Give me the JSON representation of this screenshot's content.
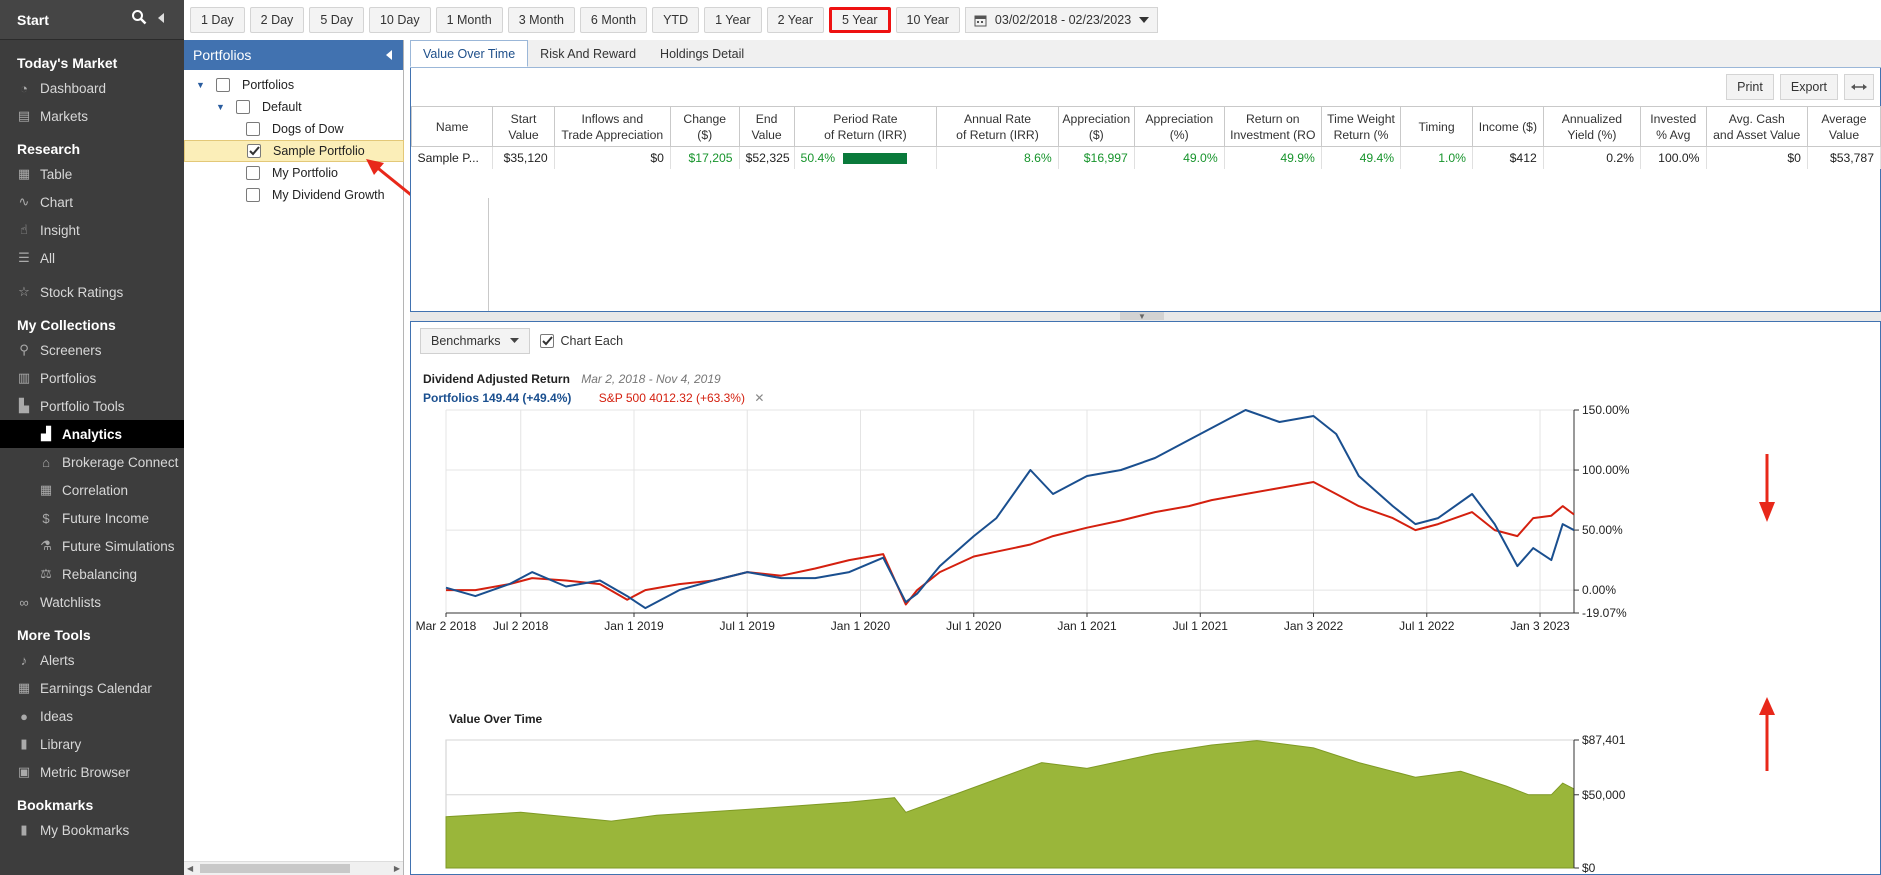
{
  "sidebar": {
    "start_label": "Start",
    "sections": [
      {
        "title": "Today's Market",
        "items": [
          {
            "label": "Dashboard",
            "icon": "dashboard-icon"
          },
          {
            "label": "Markets",
            "icon": "markets-icon"
          }
        ]
      },
      {
        "title": "Research",
        "items": [
          {
            "label": "Table",
            "icon": "table-icon"
          },
          {
            "label": "Chart",
            "icon": "chart-icon"
          },
          {
            "label": "Insight",
            "icon": "insight-icon"
          },
          {
            "label": "All",
            "icon": "list-icon"
          },
          {
            "label": "Stock Ratings",
            "icon": "star-icon"
          }
        ]
      },
      {
        "title": "My Collections",
        "items": [
          {
            "label": "Screeners",
            "icon": "search-icon"
          },
          {
            "label": "Portfolios",
            "icon": "portfolios-icon"
          },
          {
            "label": "Portfolio Tools",
            "icon": "portfolio-tools-icon"
          },
          {
            "label": "Analytics",
            "icon": "analytics-icon",
            "sub": true,
            "active": true
          },
          {
            "label": "Brokerage Connect",
            "icon": "bank-icon",
            "sub": true
          },
          {
            "label": "Correlation",
            "icon": "grid-icon",
            "sub": true
          },
          {
            "label": "Future Income",
            "icon": "dollar-icon",
            "sub": true
          },
          {
            "label": "Future Simulations",
            "icon": "flask-icon",
            "sub": true
          },
          {
            "label": "Rebalancing",
            "icon": "scale-icon",
            "sub": true
          },
          {
            "label": "Watchlists",
            "icon": "binoculars-icon"
          }
        ]
      },
      {
        "title": "More Tools",
        "items": [
          {
            "label": "Alerts",
            "icon": "bell-icon"
          },
          {
            "label": "Earnings Calendar",
            "icon": "calendar-icon"
          },
          {
            "label": "Ideas",
            "icon": "lightbulb-icon"
          },
          {
            "label": "Library",
            "icon": "book-icon"
          },
          {
            "label": "Metric Browser",
            "icon": "browser-icon"
          }
        ]
      },
      {
        "title": "Bookmarks",
        "items": [
          {
            "label": "My Bookmarks",
            "icon": "bookmark-icon"
          }
        ]
      }
    ]
  },
  "periods": [
    "1 Day",
    "2 Day",
    "5 Day",
    "10 Day",
    "1 Month",
    "3 Month",
    "6 Month",
    "YTD",
    "1 Year",
    "2 Year",
    "5 Year",
    "10 Year"
  ],
  "selected_period": "5 Year",
  "date_range": "03/02/2018 - 02/23/2023",
  "portfolios_panel": {
    "title": "Portfolios",
    "root": "Portfolios",
    "group": "Default",
    "items": [
      {
        "label": "Dogs of Dow",
        "checked": false
      },
      {
        "label": "Sample Portfolio",
        "checked": true
      },
      {
        "label": "My Portfolio",
        "checked": false
      },
      {
        "label": "My Dividend Growth",
        "checked": false
      }
    ]
  },
  "tabs": [
    "Value Over Time",
    "Risk And Reward",
    "Holdings Detail"
  ],
  "table_tools": {
    "print": "Print",
    "export": "Export"
  },
  "table": {
    "headers": [
      [
        "Name"
      ],
      [
        "Start",
        "Value"
      ],
      [
        "Inflows and",
        "Trade Appreciation"
      ],
      [
        "Change",
        "($)"
      ],
      [
        "End",
        "Value"
      ],
      [
        "Period Rate",
        "of Return (IRR)"
      ],
      [
        "Annual Rate",
        "of Return (IRR)"
      ],
      [
        "Appreciation",
        "($)"
      ],
      [
        "Appreciation",
        "(%)"
      ],
      [
        "Return on",
        "Investment (RO"
      ],
      [
        "Time Weight",
        "Return (%"
      ],
      [
        "Timing"
      ],
      [
        "Income ($)"
      ],
      [
        "Annualized",
        "Yield (%)"
      ],
      [
        "Invested",
        "% Avg"
      ],
      [
        "Avg. Cash",
        "and Asset Value"
      ],
      [
        "Average",
        "Value"
      ]
    ],
    "row": {
      "name": "Sample P...",
      "start_value": "$35,120",
      "inflows": "$0",
      "change": "$17,205",
      "end_value": "$52,325",
      "period_irr": "50.4%",
      "period_irr_fraction": 0.504,
      "annual_irr": "8.6%",
      "appreciation_usd": "$16,997",
      "appreciation_pct": "49.0%",
      "roi": "49.9%",
      "twr": "49.4%",
      "timing": "1.0%",
      "income": "$412",
      "yield": "0.2%",
      "invested": "100.0%",
      "avg_cash": "$0",
      "avg_value": "$53,787"
    }
  },
  "chart_controls": {
    "benchmarks": "Benchmarks",
    "chart_each": "Chart Each",
    "chart_each_checked": true
  },
  "chart_data": [
    {
      "type": "line",
      "title": "Dividend Adjusted Return",
      "subtitle": "Mar 2, 2018 - Nov 4, 2019",
      "x_ticks": [
        "Mar 2 2018",
        "Jul 2 2018",
        "Jan 1 2019",
        "Jul 1 2019",
        "Jan 1 2020",
        "Jul 1 2020",
        "Jan 1 2021",
        "Jul 1 2021",
        "Jan 3 2022",
        "Jul 1 2022",
        "Jan 3 2023"
      ],
      "x_tick_years": [
        2018.17,
        2018.5,
        2019.0,
        2019.5,
        2020.0,
        2020.5,
        2021.0,
        2021.5,
        2022.0,
        2022.5,
        2023.0
      ],
      "x_range": [
        2018.17,
        2023.15
      ],
      "y_ticks": [
        "150.00%",
        "100.00%",
        "50.00%",
        "0.00%",
        "-19.07%"
      ],
      "y_tick_values": [
        150,
        100,
        50,
        0,
        -19.07
      ],
      "ylim": [
        -19.07,
        150
      ],
      "grid": true,
      "legend_placement": "top-left",
      "series": [
        {
          "name": "Portfolios 149.44 (+49.4%)",
          "color": "#1a4f8f",
          "x": [
            2018.17,
            2018.3,
            2018.45,
            2018.55,
            2018.7,
            2018.85,
            2018.97,
            2019.05,
            2019.2,
            2019.35,
            2019.5,
            2019.65,
            2019.8,
            2019.95,
            2020.1,
            2020.2,
            2020.25,
            2020.35,
            2020.5,
            2020.6,
            2020.75,
            2020.85,
            2021.0,
            2021.15,
            2021.3,
            2021.45,
            2021.55,
            2021.7,
            2021.85,
            2022.0,
            2022.1,
            2022.2,
            2022.35,
            2022.45,
            2022.55,
            2022.7,
            2022.8,
            2022.9,
            2022.97,
            2023.05,
            2023.1,
            2023.15
          ],
          "y": [
            2,
            -5,
            5,
            15,
            3,
            8,
            -5,
            -15,
            0,
            8,
            15,
            10,
            10,
            15,
            27,
            -10,
            -3,
            20,
            45,
            60,
            100,
            80,
            95,
            100,
            110,
            125,
            135,
            150,
            140,
            145,
            130,
            95,
            70,
            55,
            60,
            80,
            55,
            20,
            35,
            25,
            55,
            50
          ]
        },
        {
          "name": "S&P 500 4012.32 (+63.3%)",
          "color": "#d4200f",
          "x": [
            2018.17,
            2018.3,
            2018.45,
            2018.55,
            2018.7,
            2018.85,
            2018.97,
            2019.05,
            2019.2,
            2019.35,
            2019.5,
            2019.65,
            2019.8,
            2019.95,
            2020.1,
            2020.2,
            2020.25,
            2020.35,
            2020.5,
            2020.6,
            2020.75,
            2020.85,
            2021.0,
            2021.15,
            2021.3,
            2021.45,
            2021.55,
            2021.7,
            2021.85,
            2022.0,
            2022.1,
            2022.2,
            2022.35,
            2022.45,
            2022.55,
            2022.7,
            2022.8,
            2022.9,
            2022.97,
            2023.05,
            2023.1,
            2023.15
          ],
          "y": [
            0,
            0,
            5,
            10,
            8,
            5,
            -8,
            0,
            5,
            8,
            15,
            12,
            18,
            25,
            30,
            -12,
            0,
            15,
            28,
            32,
            38,
            45,
            52,
            58,
            65,
            70,
            75,
            80,
            85,
            90,
            80,
            70,
            60,
            50,
            55,
            65,
            50,
            45,
            60,
            62,
            70,
            63
          ]
        }
      ]
    },
    {
      "type": "area",
      "title": "Value Over Time",
      "y_ticks": [
        "$87,401",
        "$50,000",
        "$0"
      ],
      "y_tick_values": [
        87401,
        50000,
        0
      ],
      "ylim": [
        0,
        87401
      ],
      "x_range": [
        2018.17,
        2023.15
      ],
      "color": "#9ab63a",
      "series": [
        {
          "x": [
            2018.17,
            2018.5,
            2018.9,
            2019.1,
            2019.5,
            2019.95,
            2020.15,
            2020.2,
            2020.5,
            2020.8,
            2021.0,
            2021.3,
            2021.55,
            2021.75,
            2022.0,
            2022.2,
            2022.45,
            2022.65,
            2022.85,
            2022.95,
            2023.05,
            2023.1,
            2023.15
          ],
          "y": [
            35000,
            38000,
            32000,
            36000,
            40000,
            45000,
            48000,
            38000,
            55000,
            72000,
            68000,
            78000,
            84000,
            87000,
            82000,
            72000,
            62000,
            66000,
            56000,
            50000,
            50000,
            58000,
            54000
          ]
        }
      ]
    }
  ]
}
